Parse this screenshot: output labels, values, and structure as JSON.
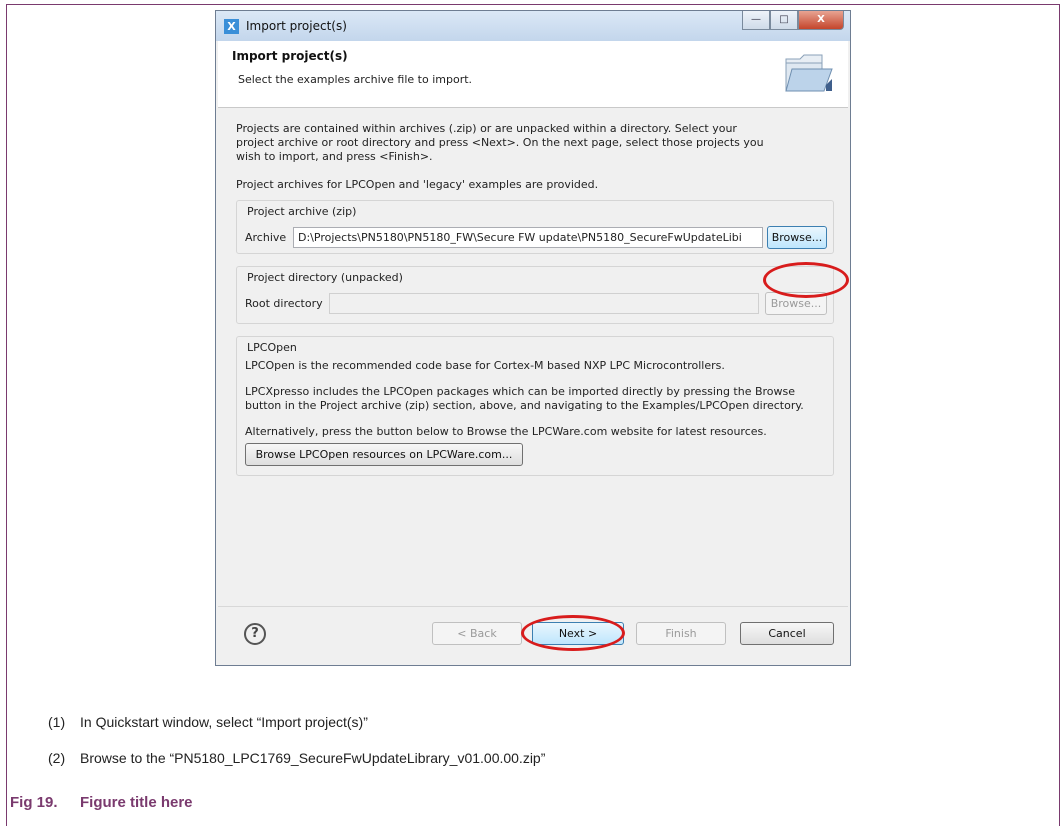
{
  "dialog": {
    "window_title": "Import project(s)",
    "header_title": "Import project(s)",
    "header_subtitle": "Select the examples archive file to import.",
    "intro_line1": "Projects are contained within archives (.zip) or are unpacked within a directory. Select your",
    "intro_line2": "project archive or root directory and press <Next>. On the next page, select those projects you",
    "intro_line3": "wish to import, and press <Finish>.",
    "intro2": "Project archives for LPCOpen and 'legacy' examples are provided.",
    "archive_group": {
      "label": "Project archive (zip)",
      "field_label": "Archive",
      "value": "D:\\Projects\\PN5180\\PN5180_FW\\Secure FW update\\PN5180_SecureFwUpdateLibi",
      "browse_label": "Browse..."
    },
    "directory_group": {
      "label": "Project directory (unpacked)",
      "field_label": "Root directory",
      "value": "",
      "browse_label": "Browse..."
    },
    "lpcopen_group": {
      "label": "LPCOpen",
      "line1": "LPCOpen is the recommended code base for Cortex-M based NXP LPC Microcontrollers.",
      "line2": "LPCXpresso includes the LPCOpen packages which can be imported directly by pressing the Browse",
      "line3": "button in the Project archive (zip) section, above, and navigating to the Examples/LPCOpen directory.",
      "line4": "Alternatively, press the button below to Browse the LPCWare.com website for latest resources.",
      "resources_button": "Browse LPCOpen resources on LPCWare.com..."
    },
    "footer": {
      "help_icon": "?",
      "back": "< Back",
      "next": "Next >",
      "finish": "Finish",
      "cancel": "Cancel"
    },
    "window_buttons": {
      "minimize": "—",
      "maximize": "□",
      "close": "X"
    }
  },
  "steps": [
    {
      "num": "(1)",
      "text": "In Quickstart window, select “Import project(s)”"
    },
    {
      "num": "(2)",
      "text": "Browse to the  “PN5180_LPC1769_SecureFwUpdateLibrary_v01.00.00.zip”"
    }
  ],
  "figure": {
    "num": "Fig 19.",
    "title": "Figure title here"
  },
  "colors": {
    "highlight_oval": "#d81c1c",
    "figure_caption": "#7a3a6e"
  }
}
